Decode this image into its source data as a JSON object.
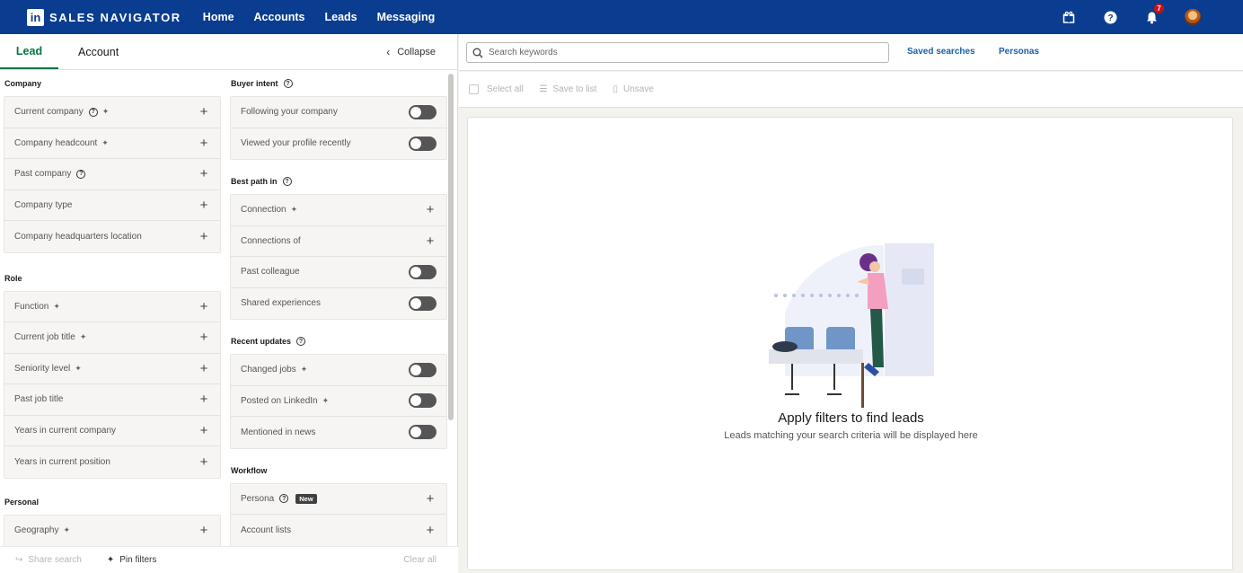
{
  "nav": {
    "logo_letters": "in",
    "brand": "SALES NAVIGATOR",
    "links": [
      "Home",
      "Accounts",
      "Leads",
      "Messaging"
    ],
    "notification_count": "7"
  },
  "tabs": {
    "lead": "Lead",
    "account": "Account",
    "collapse": "Collapse"
  },
  "left_column": {
    "company_title": "Company",
    "company": [
      "Current company",
      "Company headcount",
      "Past company",
      "Company type",
      "Company headquarters location"
    ],
    "role_title": "Role",
    "role": [
      "Function",
      "Current job title",
      "Seniority level",
      "Past job title",
      "Years in current company",
      "Years in current position"
    ],
    "personal_title": "Personal",
    "personal": [
      "Geography"
    ]
  },
  "right_column": {
    "buyer_intent_title": "Buyer intent",
    "buyer_intent": [
      "Following your company",
      "Viewed your profile recently"
    ],
    "best_path_title": "Best path in",
    "best_path": [
      "Connection",
      "Connections of",
      "Past colleague",
      "Shared experiences"
    ],
    "recent_updates_title": "Recent updates",
    "recent_updates": [
      "Changed jobs",
      "Posted on LinkedIn",
      "Mentioned in news"
    ],
    "workflow_title": "Workflow",
    "workflow": [
      "Persona",
      "Account lists"
    ],
    "new_badge": "New"
  },
  "footer": {
    "share": "Share search",
    "pin": "Pin filters",
    "clear": "Clear all"
  },
  "search": {
    "placeholder": "Search keywords",
    "saved_searches": "Saved searches",
    "personas": "Personas"
  },
  "actions": {
    "select_all": "Select all",
    "save_to_list": "Save to list",
    "unsave": "Unsave"
  },
  "empty_state": {
    "title": "Apply filters to find leads",
    "subtitle": "Leads matching your search criteria will be displayed here"
  }
}
